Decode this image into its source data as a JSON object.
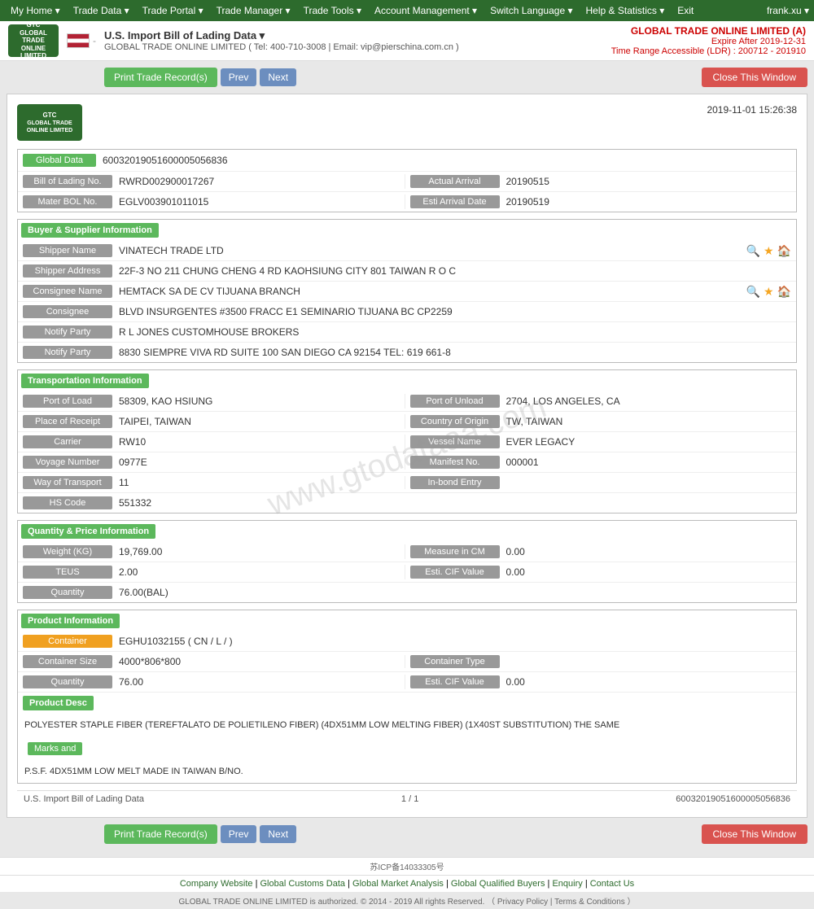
{
  "topNav": {
    "items": [
      {
        "label": "My Home ▾",
        "name": "nav-my-home"
      },
      {
        "label": "Trade Data ▾",
        "name": "nav-trade-data"
      },
      {
        "label": "Trade Portal ▾",
        "name": "nav-trade-portal"
      },
      {
        "label": "Trade Manager ▾",
        "name": "nav-trade-manager"
      },
      {
        "label": "Trade Tools ▾",
        "name": "nav-trade-tools"
      },
      {
        "label": "Account Management ▾",
        "name": "nav-account-management"
      },
      {
        "label": "Switch Language ▾",
        "name": "nav-switch-language"
      },
      {
        "label": "Help & Statistics ▾",
        "name": "nav-help"
      },
      {
        "label": "Exit",
        "name": "nav-exit"
      }
    ],
    "username": "frank.xu ▾"
  },
  "header": {
    "logoText": "GTC\nGLOBAL TRADE\nONLINE LIMITED",
    "siteTitle": "U.S. Import Bill of Lading Data ▾",
    "siteContact": "GLOBAL TRADE ONLINE LIMITED ( Tel: 400-710-3008 | Email: vip@pierschina.com.cn )",
    "brand": "GLOBAL TRADE ONLINE LIMITED (A)",
    "expire": "Expire After 2019-12-31",
    "timeRange": "Time Range Accessible (LDR) : 200712 - 201910"
  },
  "toolbar": {
    "printLabel": "Print Trade Record(s)",
    "prevLabel": "Prev",
    "nextLabel": "Next",
    "closeLabel": "Close This Window"
  },
  "doc": {
    "logoText": "GTC",
    "logoSub": "GLOBAL TRADE ONLINE LIMITED",
    "datetime": "2019-11-01 15:26:38",
    "globalData": {
      "label": "Global Data",
      "value": "60032019051600005056836"
    },
    "billOfLading": {
      "label": "Bill of Lading No.",
      "value": "RWRD002900017267",
      "actualArrivalLabel": "Actual Arrival",
      "actualArrivalValue": "20190515"
    },
    "masterBOL": {
      "label": "Mater BOL No.",
      "value": "EGLV003901011015",
      "estiArrivalLabel": "Esti Arrival Date",
      "estiArrivalValue": "20190519"
    },
    "buyerSupplier": {
      "sectionTitle": "Buyer & Supplier Information",
      "shipperName": {
        "label": "Shipper Name",
        "value": "VINATECH TRADE LTD"
      },
      "shipperAddress": {
        "label": "Shipper Address",
        "value": "22F-3 NO 211 CHUNG CHENG 4 RD KAOHSIUNG CITY 801 TAIWAN R O C"
      },
      "consigneeName": {
        "label": "Consignee Name",
        "value": "HEMTACK SA DE CV TIJUANA BRANCH"
      },
      "consignee": {
        "label": "Consignee",
        "value": "BLVD INSURGENTES #3500 FRACC E1 SEMINARIO TIJUANA BC CP2259"
      },
      "notifyParty1": {
        "label": "Notify Party",
        "value": "R L JONES CUSTOMHOUSE BROKERS"
      },
      "notifyParty2": {
        "label": "Notify Party",
        "value": "8830 SIEMPRE VIVA RD SUITE 100 SAN DIEGO CA 92154 TEL: 619 661-8"
      }
    },
    "transportation": {
      "sectionTitle": "Transportation Information",
      "portOfLoad": {
        "label": "Port of Load",
        "value": "58309, KAO HSIUNG"
      },
      "portOfUnload": {
        "label": "Port of Unload",
        "value": "2704, LOS ANGELES, CA"
      },
      "placeOfReceipt": {
        "label": "Place of Receipt",
        "value": "TAIPEI, TAIWAN"
      },
      "countryOfOrigin": {
        "label": "Country of Origin",
        "value": "TW, TAIWAN"
      },
      "carrier": {
        "label": "Carrier",
        "value": "RW10"
      },
      "vesselName": {
        "label": "Vessel Name",
        "value": "EVER LEGACY"
      },
      "voyageNumber": {
        "label": "Voyage Number",
        "value": "0977E"
      },
      "manifestNo": {
        "label": "Manifest No.",
        "value": "000001"
      },
      "wayOfTransport": {
        "label": "Way of Transport",
        "value": "11"
      },
      "inBondEntry": {
        "label": "In-bond Entry",
        "value": ""
      },
      "hsCode": {
        "label": "HS Code",
        "value": "551332"
      }
    },
    "quantityPrice": {
      "sectionTitle": "Quantity & Price Information",
      "weightKG": {
        "label": "Weight (KG)",
        "value": "19,769.00"
      },
      "measureInCM": {
        "label": "Measure in CM",
        "value": "0.00"
      },
      "teus": {
        "label": "TEUS",
        "value": "2.00"
      },
      "estiCIFValue": {
        "label": "Esti. CIF Value",
        "value": "0.00"
      },
      "quantity": {
        "label": "Quantity",
        "value": "76.00(BAL)"
      }
    },
    "productInfo": {
      "sectionTitle": "Product Information",
      "container": {
        "label": "Container",
        "value": "EGHU1032155 ( CN / L / )"
      },
      "containerSize": {
        "label": "Container Size",
        "value": "4000*806*800"
      },
      "containerType": {
        "label": "Container Type",
        "value": ""
      },
      "quantity": {
        "label": "Quantity",
        "value": "76.00"
      },
      "estiCIFValue": {
        "label": "Esti. CIF Value",
        "value": "0.00"
      },
      "productDescLabel": "Product Desc",
      "productDesc": "POLYESTER STAPLE FIBER (TEREFTALATO DE POLIETILENO FIBER) (4DX51MM LOW MELTING FIBER) (1X40ST SUBSTITUTION) THE SAME",
      "marksLabel": "Marks and",
      "marksValue": "P.S.F. 4DX51MM LOW MELT MADE IN TAIWAN B/NO."
    }
  },
  "docFooter": {
    "leftText": "U.S. Import Bill of Lading Data",
    "pageInfo": "1 / 1",
    "rightText": "60032019051600005056836"
  },
  "toolbar2": {
    "printLabel": "Print Trade Record(s)",
    "prevLabel": "Prev",
    "nextLabel": "Next",
    "closeLabel": "Close This Window"
  },
  "footer": {
    "icp": "苏ICP备14033305号",
    "links": [
      "Company Website",
      "Global Customs Data",
      "Global Market Analysis",
      "Global Qualified Buyers",
      "Enquiry",
      "Contact Us"
    ],
    "copyright": "GLOBAL TRADE ONLINE LIMITED is authorized. © 2014 - 2019 All rights Reserved. （ Privacy Policy | Terms & Conditions ）"
  },
  "watermark": "www.gtodataaa.com"
}
